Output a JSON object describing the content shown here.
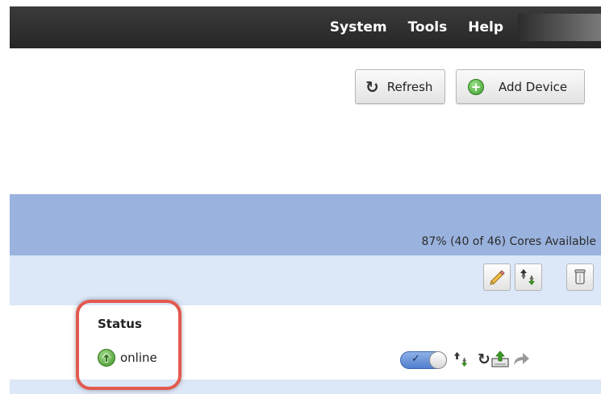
{
  "menu": {
    "items": [
      "System",
      "Tools",
      "Help"
    ]
  },
  "toolbar": {
    "refresh_label": "Refresh",
    "add_device_label": "Add Device"
  },
  "cluster": {
    "cores_available": "87% (40 of 46) Cores Available"
  },
  "device": {
    "status_header": "Status",
    "status_value": "online"
  },
  "icons": {
    "refresh": "refresh-icon",
    "add": "add-circle-icon",
    "edit": "pencil-icon",
    "move": "move-updown-icon",
    "delete": "trash-icon",
    "online": "arrow-up-circle-icon",
    "toggle": "toggle-switch-icon",
    "deploy": "deploy-icon",
    "redirect": "redirect-arrow-icon"
  },
  "colors": {
    "topbar": "#2f2f2f",
    "header_band": "#9ab3de",
    "row_band": "#dce7f8",
    "highlight": "#e25a4f",
    "online_green": "#3e9324"
  }
}
